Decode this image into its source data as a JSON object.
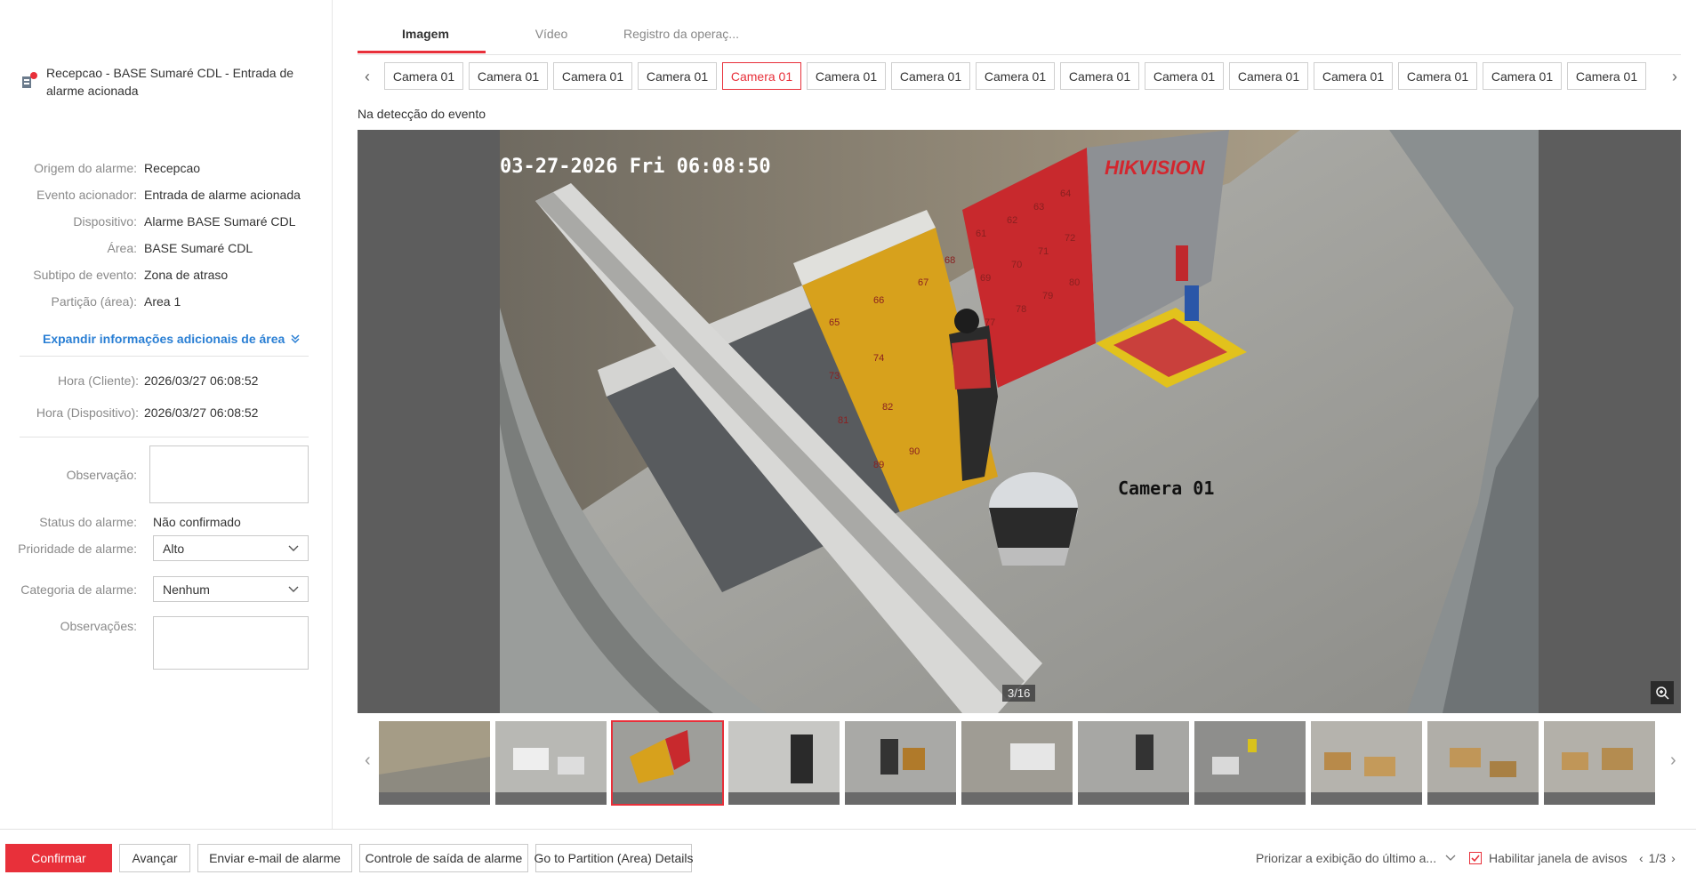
{
  "alarm": {
    "title": "Recepcao - BASE Sumaré CDL - Entrada de alarme acionada",
    "details": [
      {
        "label": "Origem do alarme:",
        "value": "Recepcao"
      },
      {
        "label": "Evento acionador:",
        "value": "Entrada de alarme acionada"
      },
      {
        "label": "Dispositivo:",
        "value": "Alarme BASE Sumaré CDL"
      },
      {
        "label": "Área:",
        "value": "BASE Sumaré CDL"
      },
      {
        "label": "Subtipo de evento:",
        "value": "Zona de atraso"
      },
      {
        "label": "Partição (área):",
        "value": "Area 1"
      }
    ],
    "expand_label": "Expandir informações adicionais de área",
    "time_client_label": "Hora (Cliente):",
    "time_client_value": "2026/03/27 06:08:52",
    "time_device_label": "Hora (Dispositivo):",
    "time_device_value": "2026/03/27 06:08:52",
    "observation_label": "Observação:",
    "status_label": "Status do alarme:",
    "status_value": "Não confirmado",
    "priority_label": "Prioridade de alarme:",
    "priority_value": "Alto",
    "category_label": "Categoria de alarme:",
    "category_value": "Nenhum",
    "remarks_label": "Observações:"
  },
  "tabs": [
    "Imagem",
    "Vídeo",
    "Registro da operaç..."
  ],
  "cameras": [
    "Camera 01",
    "Camera 01",
    "Camera 01",
    "Camera 01",
    "Camera 01",
    "Camera 01",
    "Camera 01",
    "Camera 01",
    "Camera 01",
    "Camera 01",
    "Camera 01",
    "Camera 01",
    "Camera 01",
    "Camera 01",
    "Camera 01"
  ],
  "active_camera_index": 4,
  "caption": "Na detecção do evento",
  "viewer": {
    "osd_timestamp": "03-27-2026 Fri 06:08:50",
    "osd_brand": "HIKVISION",
    "osd_camera": "Camera 01",
    "counter": "3/16"
  },
  "locker_numbers": [
    "65",
    "66",
    "67",
    "68",
    "73",
    "74",
    "81",
    "82",
    "89",
    "90",
    "61",
    "62",
    "63",
    "64",
    "69",
    "70",
    "71",
    "72",
    "77",
    "78",
    "79",
    "80"
  ],
  "footer": {
    "confirm": "Confirmar",
    "next": "Avançar",
    "email": "Enviar e-mail de alarme",
    "output": "Controle de saída de alarme",
    "partition": "Go to Partition (Area) Details",
    "priority_display": "Priorizar a exibição do último a...",
    "enable_popup": "Habilitar janela de avisos",
    "pager": "1/3"
  },
  "colors": {
    "accent": "#e8303a",
    "link": "#2a7fd4"
  }
}
